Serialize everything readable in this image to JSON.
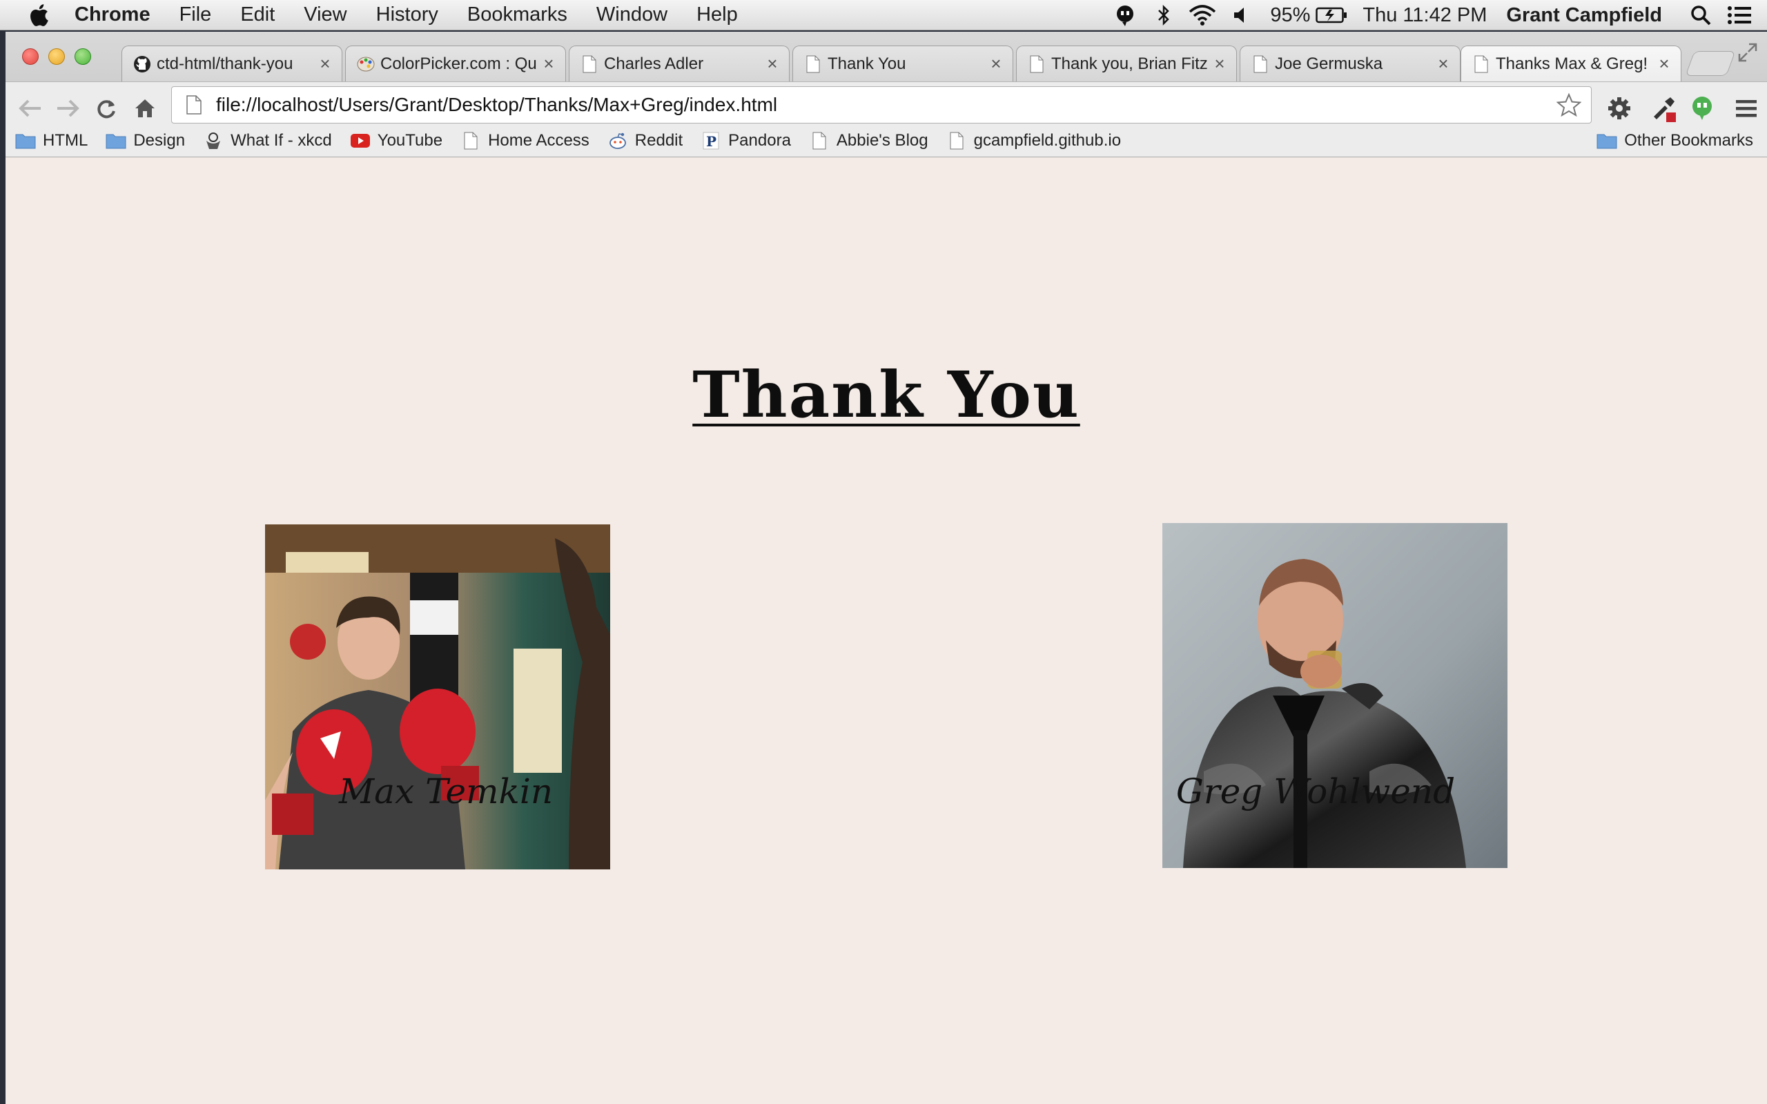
{
  "menubar": {
    "app": "Chrome",
    "items": [
      "File",
      "Edit",
      "View",
      "History",
      "Bookmarks",
      "Window",
      "Help"
    ],
    "battery": "95%",
    "clock": "Thu 11:42 PM",
    "user": "Grant Campfield"
  },
  "tabs": [
    {
      "title": "ctd-html/thank-you",
      "icon": "github-icon"
    },
    {
      "title": "ColorPicker.com : Qu",
      "icon": "palette-icon"
    },
    {
      "title": "Charles Adler",
      "icon": "page-icon"
    },
    {
      "title": "Thank You",
      "icon": "page-icon"
    },
    {
      "title": "Thank you, Brian Fitz",
      "icon": "page-icon"
    },
    {
      "title": "Joe Germuska",
      "icon": "page-icon"
    },
    {
      "title": "Thanks Max & Greg!",
      "icon": "page-icon"
    }
  ],
  "active_tab": 6,
  "address_bar": {
    "url": "file://localhost/Users/Grant/Desktop/Thanks/Max+Greg/index.html"
  },
  "bookmarks": [
    {
      "label": "HTML",
      "icon": "folder-icon"
    },
    {
      "label": "Design",
      "icon": "folder-icon"
    },
    {
      "label": "What If - xkcd",
      "icon": "xkcd-icon"
    },
    {
      "label": "YouTube",
      "icon": "youtube-icon"
    },
    {
      "label": "Home Access",
      "icon": "page-icon"
    },
    {
      "label": "Reddit",
      "icon": "reddit-icon"
    },
    {
      "label": "Pandora",
      "icon": "pandora-icon"
    },
    {
      "label": "Abbie's Blog",
      "icon": "page-icon"
    },
    {
      "label": "gcampfield.github.io",
      "icon": "page-icon"
    }
  ],
  "other_bookmarks": "Other Bookmarks",
  "page": {
    "title": "Thank You",
    "people": [
      {
        "name": "Max Temkin"
      },
      {
        "name": "Greg Wohlwend"
      }
    ]
  },
  "colors": {
    "page_background": "#f4ebe6",
    "heading": "#0e0e0e",
    "glove_red": "#d3202a"
  }
}
